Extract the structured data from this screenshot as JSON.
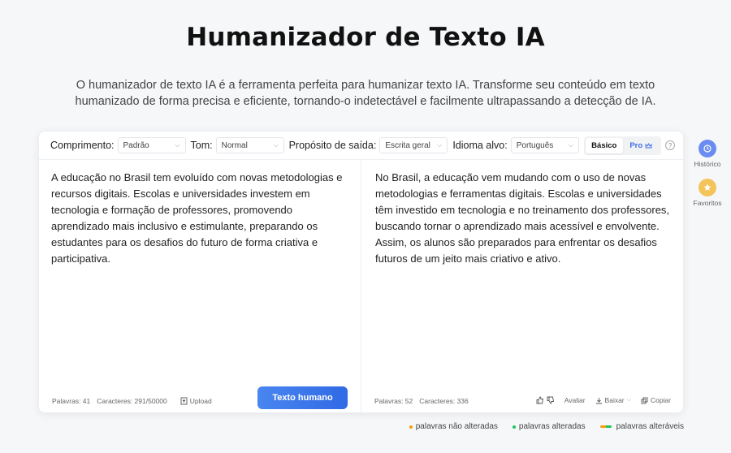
{
  "page": {
    "title": "Humanizador de Texto IA",
    "subtitle": "O humanizador de texto IA é a ferramenta perfeita para humanizar texto IA. Transforme seu conteúdo em texto humanizado de forma precisa e eficiente, tornando-o indetectável e facilmente ultrapassando a detecção de IA."
  },
  "toolbar": {
    "length_label": "Comprimento:",
    "length_value": "Padrão",
    "tone_label": "Tom:",
    "tone_value": "Normal",
    "purpose_label": "Propósito de saída:",
    "purpose_value": "Escrita geral",
    "language_label": "Idioma alvo:",
    "language_value": "Português",
    "mode_basic": "Básico",
    "mode_pro": "Pro",
    "help": "?"
  },
  "input": {
    "text": "A educação no Brasil tem evoluído com novas metodologias e recursos digitais. Escolas e universidades investem em tecnologia e formação de professores, promovendo aprendizado mais inclusivo e estimulante, preparando os estudantes para os desafios do futuro de forma criativa e participativa.",
    "words": "Palavras: 41",
    "chars": "Caracteres: 291/50000",
    "upload": "Upload",
    "submit": "Texto humano"
  },
  "output": {
    "text": "No Brasil, a educação vem mudando com o uso de novas metodologias e ferramentas digitais.   Escolas e universidades têm investido em tecnologia e no treinamento dos professores, buscando tornar o aprendizado mais acessível e envolvente.   Assim, os alunos são preparados para enfrentar os desafios futuros de um jeito mais criativo e ativo.",
    "words": "Palavras: 52",
    "chars": "Caracteres: 336",
    "rate": "Avaliar",
    "download": "Baixar",
    "copy": "Copiar"
  },
  "sidebar": {
    "history": "Histórico",
    "favorites": "Favoritos"
  },
  "legend": {
    "unchanged": "palavras não alteradas",
    "changed": "palavras alteradas",
    "changeable": "palavras alteráveis"
  },
  "colors": {
    "accent": "#2f6ae5",
    "unchanged_dot": "#f59e0b",
    "changed_dot": "#22c55e",
    "history_icon": "#6b8cf0",
    "favorites_icon": "#f4c45a"
  }
}
